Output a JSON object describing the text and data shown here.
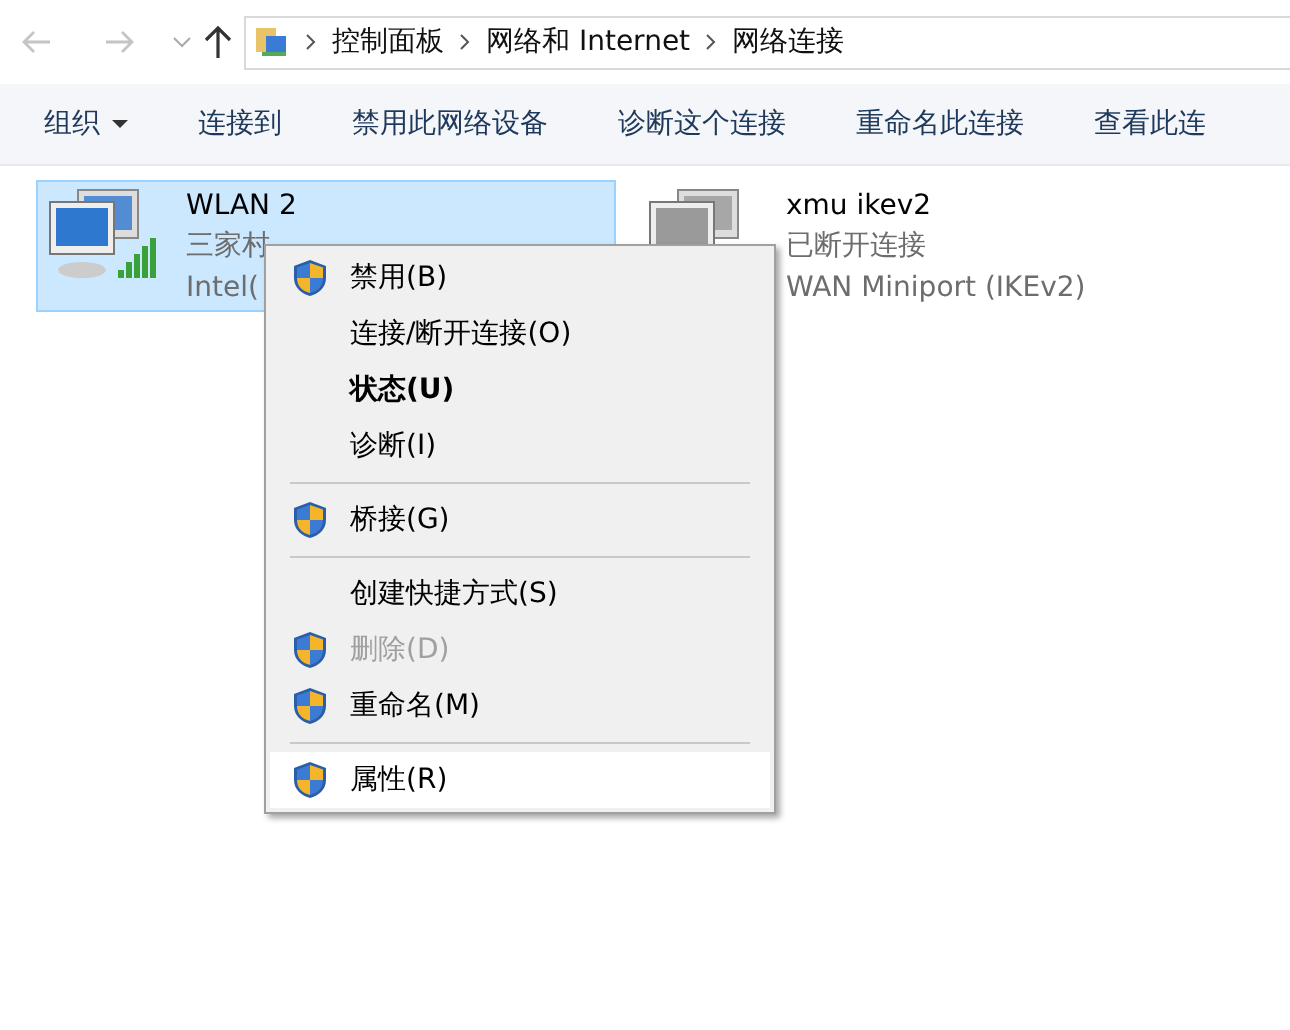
{
  "nav": {
    "back_disabled": true,
    "forward_disabled": true
  },
  "breadcrumb": [
    "控制面板",
    "网络和 Internet",
    "网络连接"
  ],
  "toolbar": [
    {
      "label": "组织",
      "dropdown": true
    },
    {
      "label": "连接到",
      "dropdown": false
    },
    {
      "label": "禁用此网络设备",
      "dropdown": false
    },
    {
      "label": "诊断这个连接",
      "dropdown": false
    },
    {
      "label": "重命名此连接",
      "dropdown": false
    },
    {
      "label": "查看此连",
      "dropdown": false
    }
  ],
  "connections": [
    {
      "name": "WLAN 2",
      "status": "三家村",
      "device": "Intel(",
      "selected": true,
      "kind": "wireless"
    },
    {
      "name": "xmu ikev2",
      "status": "已断开连接",
      "device": "WAN Miniport (IKEv2)",
      "selected": false,
      "kind": "vpn"
    }
  ],
  "context_menu": [
    {
      "kind": "item",
      "label": "禁用(B)",
      "shield": true,
      "default": false,
      "disabled": false,
      "highlighted": false
    },
    {
      "kind": "item",
      "label": "连接/断开连接(O)",
      "shield": false,
      "default": false,
      "disabled": false,
      "highlighted": false
    },
    {
      "kind": "item",
      "label": "状态(U)",
      "shield": false,
      "default": true,
      "disabled": false,
      "highlighted": false
    },
    {
      "kind": "item",
      "label": "诊断(I)",
      "shield": false,
      "default": false,
      "disabled": false,
      "highlighted": false
    },
    {
      "kind": "separator"
    },
    {
      "kind": "item",
      "label": "桥接(G)",
      "shield": true,
      "default": false,
      "disabled": false,
      "highlighted": false
    },
    {
      "kind": "separator"
    },
    {
      "kind": "item",
      "label": "创建快捷方式(S)",
      "shield": false,
      "default": false,
      "disabled": false,
      "highlighted": false
    },
    {
      "kind": "item",
      "label": "删除(D)",
      "shield": true,
      "default": false,
      "disabled": true,
      "highlighted": false
    },
    {
      "kind": "item",
      "label": "重命名(M)",
      "shield": true,
      "default": false,
      "disabled": false,
      "highlighted": false
    },
    {
      "kind": "separator"
    },
    {
      "kind": "item",
      "label": "属性(R)",
      "shield": true,
      "default": false,
      "disabled": false,
      "highlighted": true
    }
  ]
}
